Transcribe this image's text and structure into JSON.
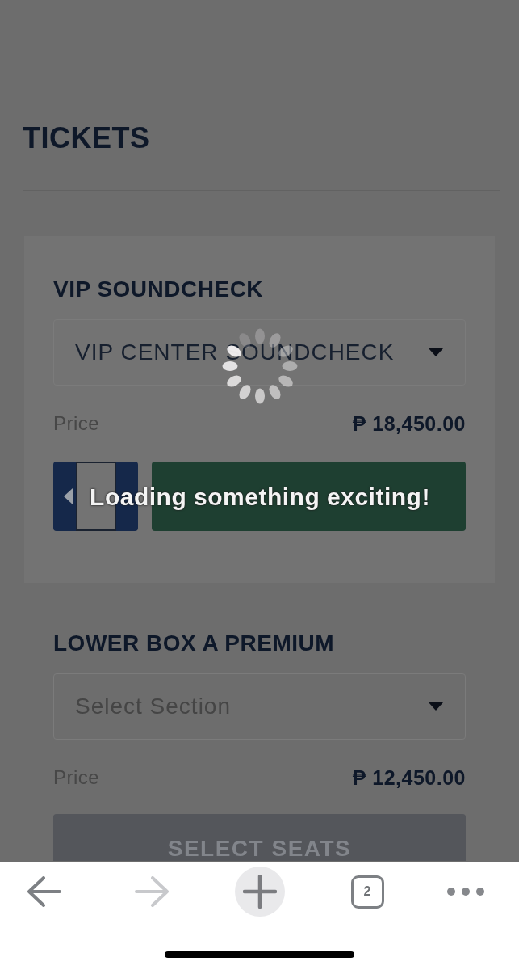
{
  "page": {
    "title": "TICKETS"
  },
  "sections": [
    {
      "heading": "VIP SOUNDCHECK",
      "selected": true,
      "dropdown": {
        "value": "VIP CENTER SOUNDCHECK"
      },
      "price_label": "Price",
      "price": "₱ 18,450.00",
      "action": {
        "kind": "quantity_add"
      }
    },
    {
      "heading": "LOWER BOX A PREMIUM",
      "selected": false,
      "dropdown": {
        "placeholder": "Select Section"
      },
      "price_label": "Price",
      "price": "₱ 12,450.00",
      "action": {
        "kind": "select_seats",
        "label": "SELECT SEATS",
        "disabled": true
      }
    }
  ],
  "loading": {
    "message": "Loading something exciting!"
  },
  "toolbar": [
    {
      "kind": "back",
      "disabled": false
    },
    {
      "kind": "forward",
      "disabled": true
    },
    {
      "kind": "new_tab",
      "disabled": false
    },
    {
      "kind": "tabs",
      "label": "2",
      "disabled": false
    },
    {
      "kind": "more",
      "disabled": false
    }
  ]
}
